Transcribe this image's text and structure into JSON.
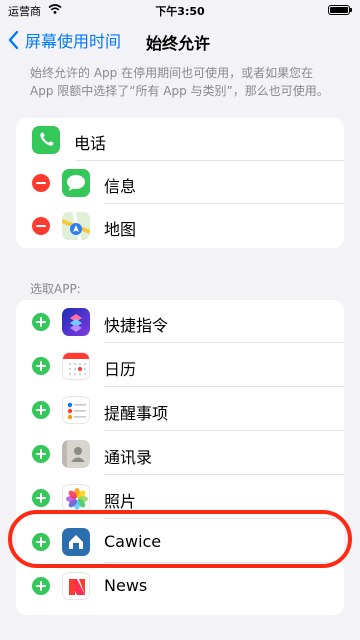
{
  "status_bar": {
    "carrier": "运营商",
    "time": "下午3:50"
  },
  "nav": {
    "back_label": "屏幕使用时间",
    "title": "始终允许"
  },
  "description": "始终允许的 App 在停用期间也可使用，或者如果您在 App 限额中选择了“所有 App 与类别”，那么也可使用。",
  "always_allowed": [
    {
      "label": "电话",
      "icon": "phone-icon",
      "removable": false
    },
    {
      "label": "信息",
      "icon": "messages-icon",
      "removable": true
    },
    {
      "label": "地图",
      "icon": "maps-icon",
      "removable": true
    }
  ],
  "choose_header": "选取APP:",
  "choose_apps": [
    {
      "label": "快捷指令",
      "icon": "shortcuts-icon"
    },
    {
      "label": "日历",
      "icon": "calendar-icon"
    },
    {
      "label": "提醒事项",
      "icon": "reminders-icon"
    },
    {
      "label": "通讯录",
      "icon": "contacts-icon"
    },
    {
      "label": "照片",
      "icon": "photos-icon"
    },
    {
      "label": "Cawice",
      "icon": "cawice-app-icon"
    },
    {
      "label": "News",
      "icon": "news-icon"
    }
  ],
  "colors": {
    "accent": "#007aff",
    "remove": "#ff3b30",
    "add": "#34c759",
    "highlight_ring": "#ff2a14"
  }
}
